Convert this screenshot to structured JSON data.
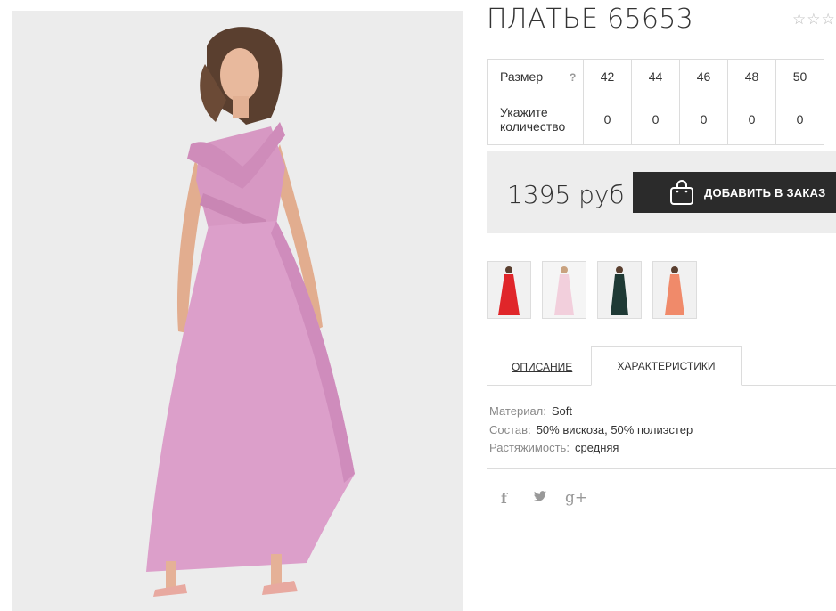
{
  "product": {
    "title": "ПЛАТЬЕ 65653",
    "rating_stars": 3,
    "image": "pink ruffled wrap maxi dress on model"
  },
  "size_table": {
    "size_label": "Размер",
    "help_icon": "?",
    "sizes": [
      "42",
      "44",
      "46",
      "48",
      "50"
    ],
    "qty_label_line1": "Укажите",
    "qty_label_line2": "количество",
    "quantities": [
      "0",
      "0",
      "0",
      "0",
      "0"
    ]
  },
  "purchase": {
    "price": "1395 руб",
    "add_to_cart_label": "ДОБАВИТЬ В ЗАКАЗ",
    "button_color": "#2b2b2b"
  },
  "color_variants": [
    {
      "color": "red",
      "hex": "#e0262a"
    },
    {
      "color": "pink",
      "hex": "#f2cfdc"
    },
    {
      "color": "dark green",
      "hex": "#1f3a35"
    },
    {
      "color": "coral",
      "hex": "#f08a6a"
    }
  ],
  "tabs": {
    "description": "ОПИСАНИЕ",
    "characteristics": "ХАРАКТЕРИСТИКИ",
    "active": "characteristics"
  },
  "characteristics": [
    {
      "key": "Материал:",
      "value": "Soft"
    },
    {
      "key": "Состав:",
      "value": "50% вискоза, 50% полиэстер"
    },
    {
      "key": "Растяжимость:",
      "value": "средняя"
    }
  ],
  "social": {
    "facebook": "f",
    "twitter": "🐦",
    "googleplus": "g+"
  }
}
